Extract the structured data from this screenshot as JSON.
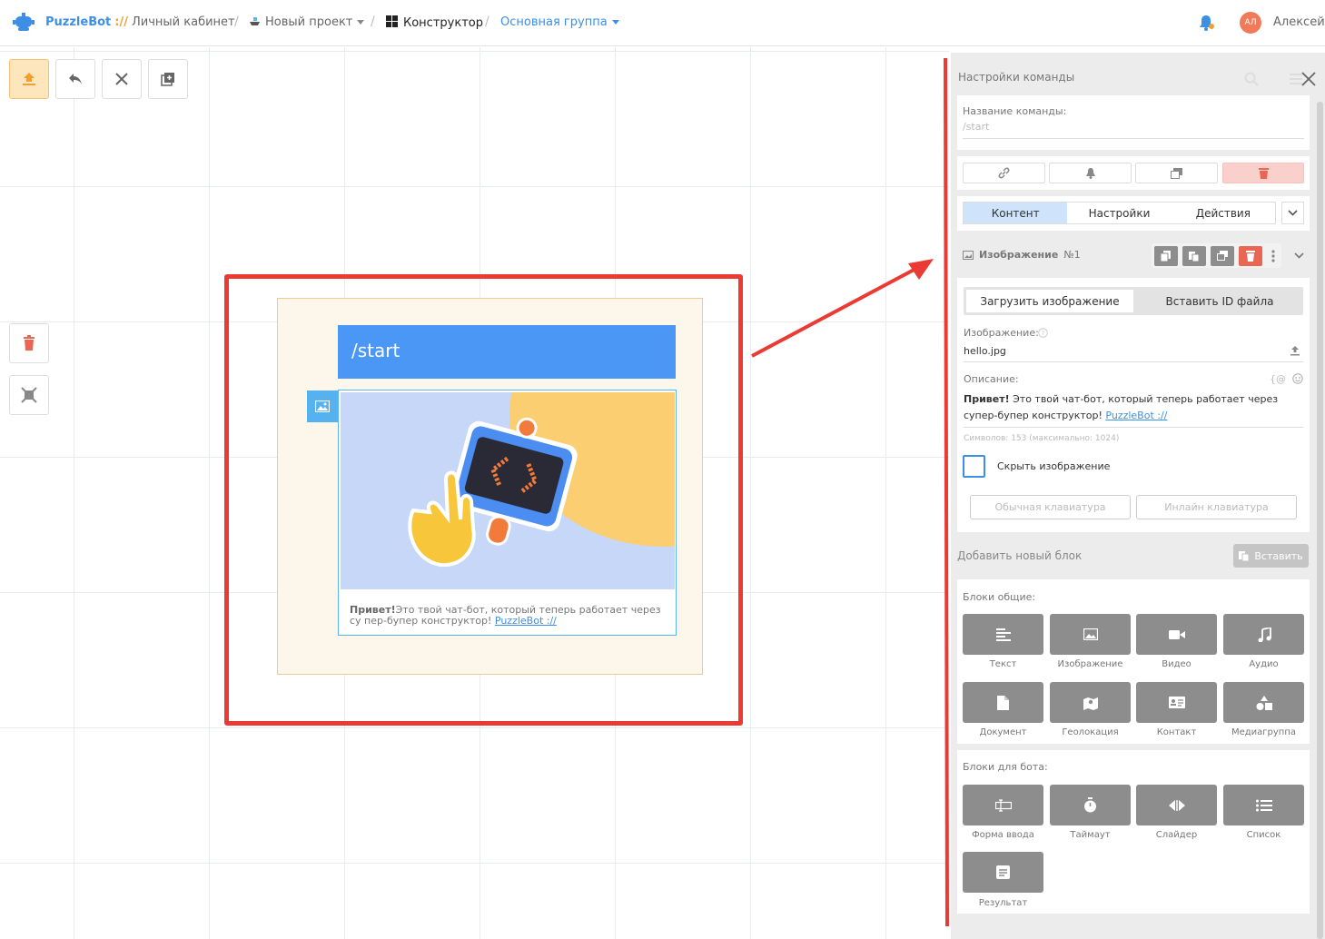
{
  "header": {
    "brand": "PuzzleBot",
    "brand_sep": "://",
    "crumbs": {
      "cabinet": "Личный кабинет",
      "project": "Новый проект",
      "builder": "Конструктор",
      "group": "Основная группа"
    },
    "avatar_initials": "АЛ",
    "username": "Алексей"
  },
  "card": {
    "title": "/start",
    "text_bold": "Привет!",
    "text": "Это твой чат-бот, который теперь работает через су пер-бупер конструктор!",
    "link": "PuzzleBot ://"
  },
  "panel": {
    "title": "Настройки команды",
    "command_name_label": "Название команды:",
    "command_name_placeholder": "/start",
    "tabs": [
      "Контент",
      "Настройки",
      "Действия"
    ],
    "block_name": "Изображение",
    "block_number": "№1",
    "upload_tab": "Загрузить изображение",
    "id_tab": "Вставить ID файла",
    "image_label": "Изображение:",
    "image_value": "hello.jpg",
    "description_label": "Описание:",
    "description_bold": "Привет!",
    "description_text": " Это твой чат-бот, который теперь работает через супер-бупер конструктор! ",
    "description_link": "PuzzleBot ://",
    "counter": "Символов: 153 (максимально: 1024)",
    "hide_image": "Скрыть изображение",
    "keyboard_normal": "Обычная клавиатура",
    "keyboard_inline": "Инлайн клавиатура",
    "add_block": "Добавить новый блок",
    "insert": "Вставить",
    "common_blocks_title": "Блоки общие:",
    "common_blocks": [
      "Текст",
      "Изображение",
      "Видео",
      "Аудио",
      "Документ",
      "Геолокация",
      "Контакт",
      "Медиагруппа"
    ],
    "bot_blocks_title": "Блоки для бота:",
    "bot_blocks": [
      "Форма ввода",
      "Таймаут",
      "Слайдер",
      "Список",
      "Результат"
    ]
  },
  "colors": {
    "accent_blue": "#4a97f5",
    "annotation_red": "#ea3a33",
    "danger": "#e96654"
  }
}
